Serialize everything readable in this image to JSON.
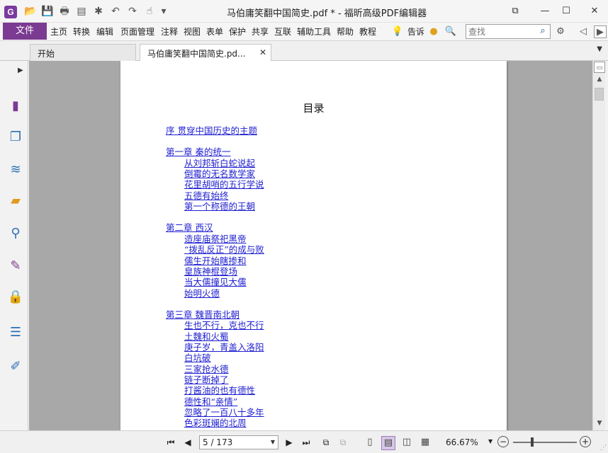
{
  "window": {
    "title": "马伯庸笑翻中国简史.pdf * - 福昕高级PDF编辑器",
    "app_logo": "G",
    "controls": {
      "pin": "⧉",
      "minimize": "—",
      "maximize": "☐",
      "close": "✕"
    }
  },
  "quick_access": [
    {
      "name": "open-folder-icon",
      "glyph": "📂"
    },
    {
      "name": "save-icon",
      "glyph": "💾"
    },
    {
      "name": "print-icon",
      "glyph": "🖶"
    },
    {
      "name": "properties-icon",
      "glyph": "▤"
    },
    {
      "name": "new-icon",
      "glyph": "✱"
    },
    {
      "name": "undo-icon",
      "glyph": "↶"
    },
    {
      "name": "redo-icon",
      "glyph": "↷"
    },
    {
      "name": "hand-tool-icon",
      "glyph": "☝"
    },
    {
      "name": "customize-dropdown-icon",
      "glyph": "▾"
    }
  ],
  "menu": {
    "file": "文件",
    "items": [
      "主页",
      "转换",
      "编辑",
      "页面管理",
      "注释",
      "视图",
      "表单",
      "保护",
      "共享",
      "互联",
      "辅助工具",
      "帮助",
      "教程"
    ],
    "tell_me": "告诉",
    "search_placeholder": "查找"
  },
  "tabs": [
    {
      "label": "开始"
    },
    {
      "label": "马伯庸笑翻中国简史.pd...",
      "active": true
    }
  ],
  "side_icons": [
    {
      "name": "page-thumbnail-icon",
      "glyph": "▮",
      "color": "#7b3b92"
    },
    {
      "name": "pages-icon",
      "glyph": "❐",
      "color": "#2a6fb8"
    },
    {
      "name": "layers-icon",
      "glyph": "≋",
      "color": "#2a6fb8"
    },
    {
      "name": "comments-icon",
      "glyph": "▰",
      "color": "#e09a1e"
    },
    {
      "name": "attachments-icon",
      "glyph": "⚲",
      "color": "#2a6fb8"
    },
    {
      "name": "signature-icon",
      "glyph": "✎",
      "color": "#7b3b92"
    },
    {
      "name": "security-lock-icon",
      "glyph": "🔒",
      "color": "#e0a020"
    },
    {
      "name": "form-fields-icon",
      "glyph": "☰",
      "color": "#2a6fb8"
    },
    {
      "name": "certify-icon",
      "glyph": "✐",
      "color": "#2a6fb8"
    }
  ],
  "document": {
    "toc_title": "目录",
    "toc": [
      {
        "text": "序 贯穿中国历史的主题",
        "level": 0
      },
      {
        "text": "第一章 秦的统一",
        "level": 0
      },
      {
        "text": "从刘邦斩白蛇说起",
        "level": 1
      },
      {
        "text": "倒霉的无名数学家",
        "level": 1
      },
      {
        "text": "花里胡哨的五行学说",
        "level": 1
      },
      {
        "text": "五德有始终",
        "level": 1
      },
      {
        "text": "第一个称德的王朝",
        "level": 1
      },
      {
        "text": "第二章 西汉",
        "level": 0
      },
      {
        "text": "造座庙祭祀黑帝",
        "level": 1
      },
      {
        "text": "“拨乱反正”的成与败",
        "level": 1
      },
      {
        "text": "儒生开始瞎掺和",
        "level": 1
      },
      {
        "text": "皇族神棍登场",
        "level": 1
      },
      {
        "text": "当大儒撞见大儒",
        "level": 1
      },
      {
        "text": "始明火德",
        "level": 1
      },
      {
        "text": "第三章 魏晋南北朝",
        "level": 0
      },
      {
        "text": "生也不行，克也不行",
        "level": 1
      },
      {
        "text": "土魏和火蜀",
        "level": 1
      },
      {
        "text": "庚子岁，青盖入洛阳",
        "level": 1
      },
      {
        "text": "白坑破",
        "level": 1
      },
      {
        "text": "三家抢水德",
        "level": 1
      },
      {
        "text": "链子断掉了",
        "level": 1
      },
      {
        "text": "打酱油的也有德性",
        "level": 1
      },
      {
        "text": "德性和“亲情”",
        "level": 1
      },
      {
        "text": "忽略了一百八十多年",
        "level": 1
      },
      {
        "text": "色彩斑斓的北周",
        "level": 1
      }
    ]
  },
  "status": {
    "page_indicator": "5 / 173",
    "zoom": "66.67%"
  },
  "colors": {
    "accent": "#7b3b92",
    "link": "#1f1fd0",
    "viewport_bg": "#a8a8a8"
  }
}
